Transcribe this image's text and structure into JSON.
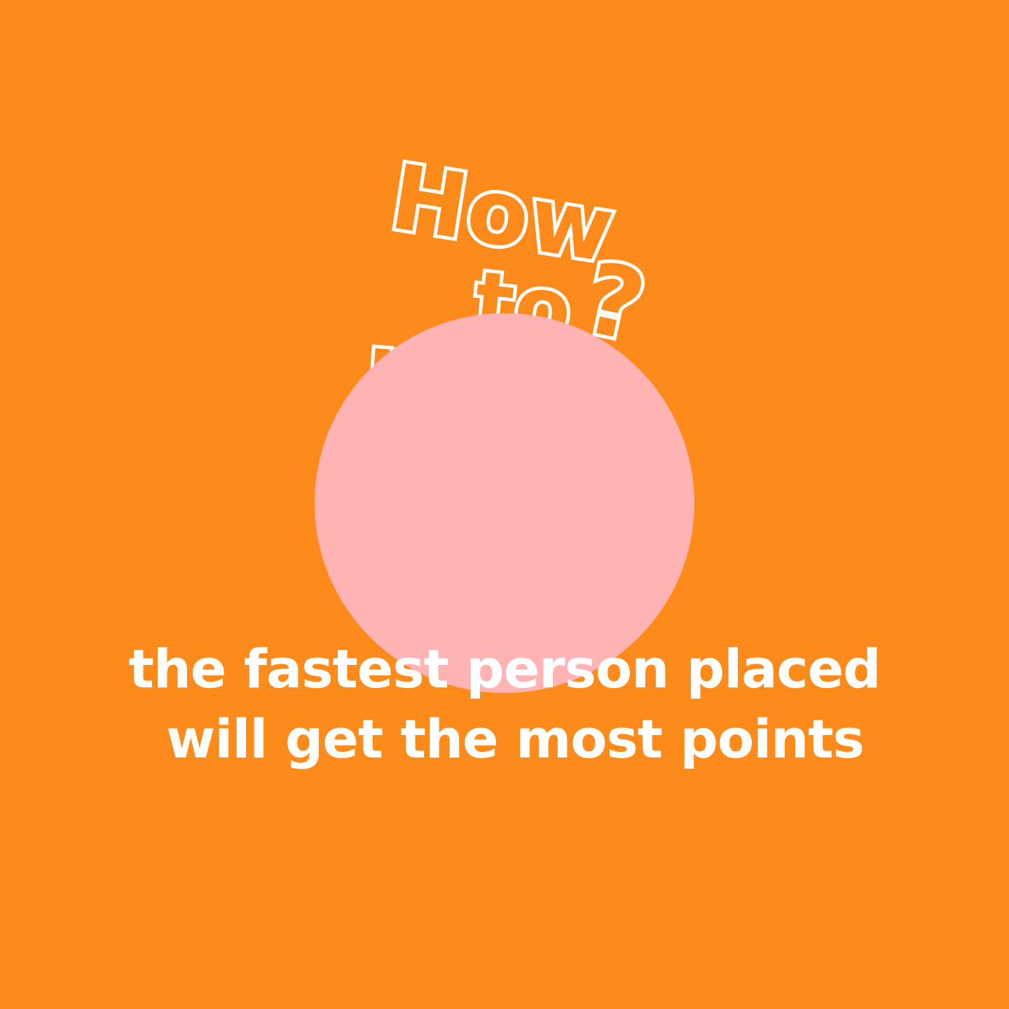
{
  "colors": {
    "background": "#FD8B1B",
    "circle": "#FFB3B3",
    "title_fill": "#FD8B1B",
    "title_outline": "#FFFFFF",
    "text": "#FFFFFF"
  },
  "title": {
    "word1": "How",
    "word2": "to",
    "word3": "play",
    "mark": "?"
  },
  "rules": {
    "line1": "the fastest person placed",
    "line2": "will get the most points"
  }
}
